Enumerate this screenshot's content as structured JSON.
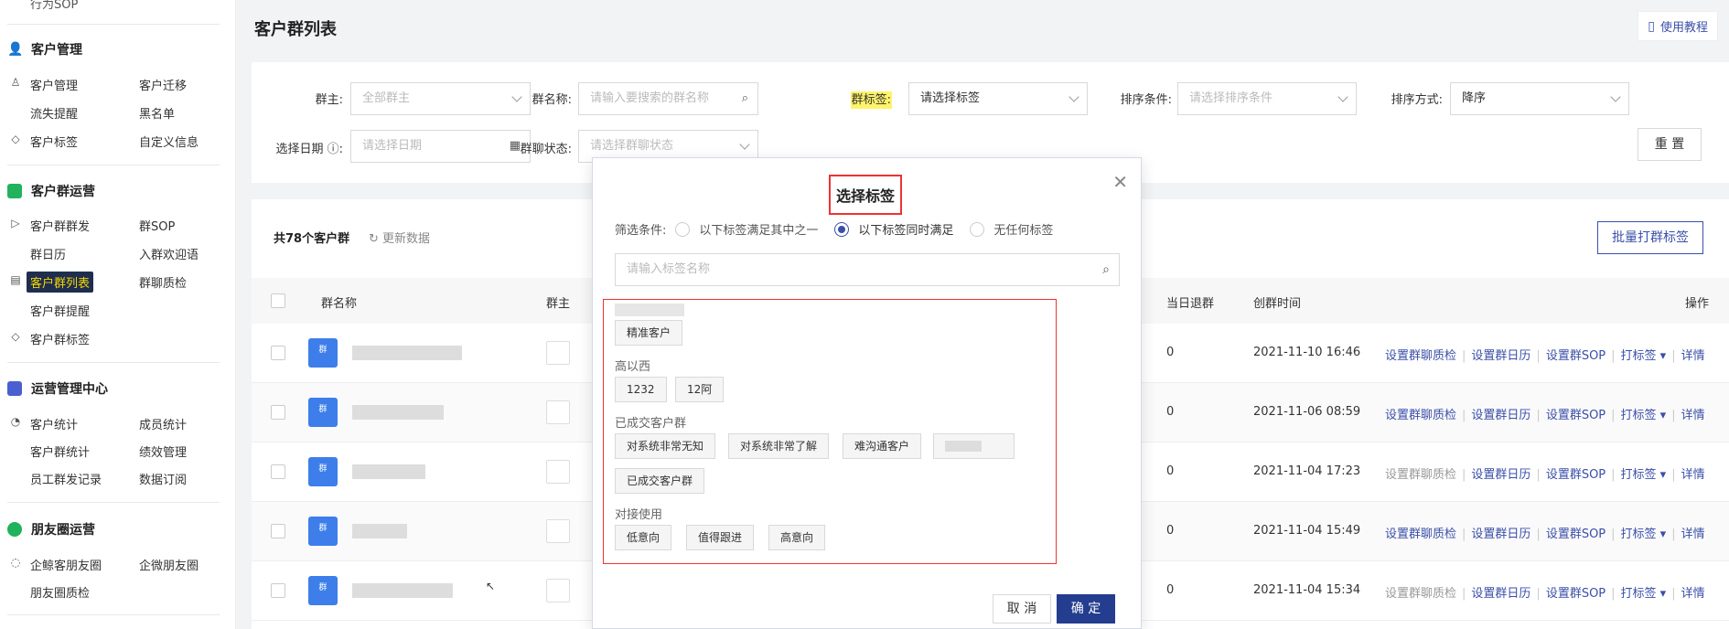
{
  "sidebar": {
    "cut_item": "行为SOP",
    "sections": [
      {
        "title": "客户管理",
        "items": [
          "客户管理",
          "客户迁移",
          "流失提醒",
          "黑名单",
          "客户标签",
          "自定义信息"
        ]
      },
      {
        "title": "客户群运营",
        "items": [
          "客户群群发",
          "群SOP",
          "群日历",
          "入群欢迎语",
          "客户群列表",
          "群聊质检",
          "客户群提醒",
          "客户群标签"
        ]
      },
      {
        "title": "运营管理中心",
        "items": [
          "客户统计",
          "成员统计",
          "客户群统计",
          "绩效管理",
          "员工群发记录",
          "数据订阅"
        ]
      },
      {
        "title": "朋友圈运营",
        "items": [
          "企鲸客朋友圈",
          "企微朋友圈",
          "朋友圈质检"
        ]
      }
    ],
    "active_item": "客户群列表"
  },
  "header": {
    "title": "客户群列表",
    "help": "使用教程"
  },
  "filters": {
    "owner_label": "群主:",
    "owner_placeholder": "全部群主",
    "name_label": "群名称:",
    "name_placeholder": "请输入要搜索的群名称",
    "tag_label": "群标签:",
    "tag_placeholder": "请选择标签",
    "sort_label": "排序条件:",
    "sort_placeholder": "请选择排序条件",
    "order_label": "排序方式:",
    "order_value": "降序",
    "date_label": "选择日期",
    "date_placeholder": "请选择日期",
    "status_label": "群聊状态:",
    "status_placeholder": "请选择群聊状态",
    "reset": "重 置"
  },
  "table": {
    "count": "共78个客户群",
    "refresh": "更新数据",
    "batch": "批量打群标签",
    "columns": [
      "群名称",
      "群主",
      "当日退群",
      "创群时间",
      "操作"
    ],
    "rows": [
      {
        "quit": "0",
        "created": "2021-11-10 16:46",
        "qc_enabled": true
      },
      {
        "quit": "0",
        "created": "2021-11-06 08:59",
        "qc_enabled": true
      },
      {
        "quit": "0",
        "created": "2021-11-04 17:23",
        "qc_enabled": false
      },
      {
        "quit": "0",
        "created": "2021-11-04 15:49",
        "qc_enabled": true
      },
      {
        "quit": "0",
        "created": "2021-11-04 15:34",
        "qc_enabled": false
      }
    ],
    "actions": {
      "qc": "设置群聊质检",
      "cal": "设置群日历",
      "sop": "设置群SOP",
      "tag": "打标签",
      "detail": "详情"
    },
    "group_icon_text": "群"
  },
  "modal": {
    "title": "选择标签",
    "filter_label": "筛选条件:",
    "options": [
      "以下标签满足其中之一",
      "以下标签同时满足",
      "无任何标签"
    ],
    "selected_option": 1,
    "search_placeholder": "请输入标签名称",
    "groups": [
      {
        "name": "",
        "tags": [
          "精准客户"
        ]
      },
      {
        "name": "高以西",
        "tags": [
          "1232",
          "12阿"
        ]
      },
      {
        "name": "已成交客户群",
        "tags": [
          "对系统非常无知",
          "对系统非常了解",
          "难沟通客户",
          "",
          "已成交客户群"
        ]
      },
      {
        "name": "对接使用",
        "tags": [
          "低意向",
          "值得跟进",
          "高意向"
        ]
      }
    ],
    "cancel": "取 消",
    "ok": "确 定"
  },
  "colors": {
    "accent": "#3a4fa8",
    "primary_btn": "#243d8f",
    "highlight": "#fff36a",
    "annotation": "#e33333"
  }
}
